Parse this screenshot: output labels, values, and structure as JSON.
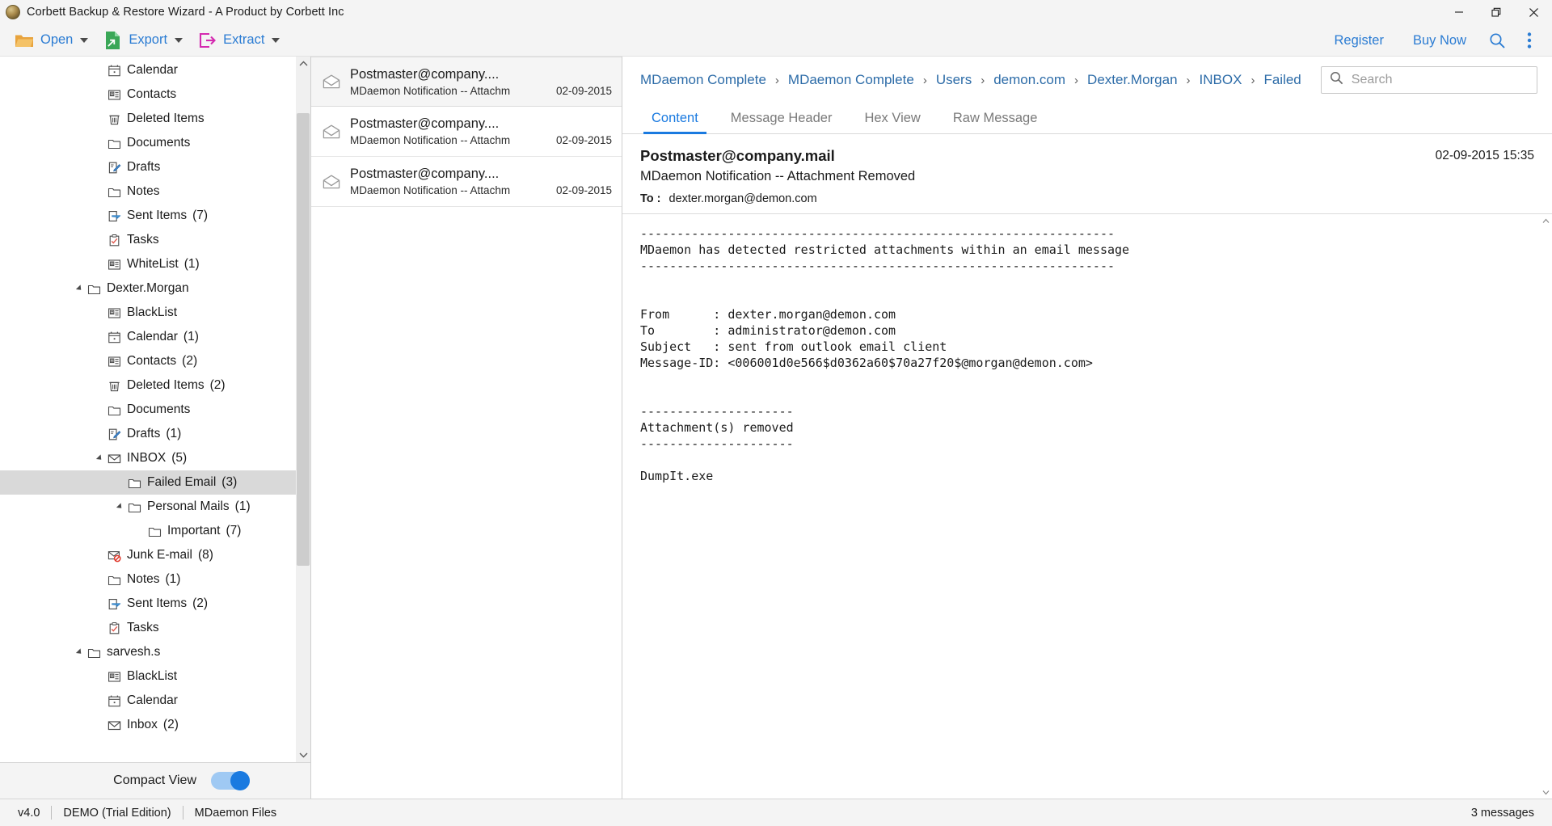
{
  "window": {
    "title": "Corbett Backup & Restore Wizard - A Product by Corbett Inc",
    "logo_icon": "corbett-logo-icon",
    "minimize_icon": "minimize-icon",
    "restore_icon": "restore-icon",
    "close_icon": "close-icon"
  },
  "toolbar": {
    "groups": [
      {
        "label": "Open",
        "icon": "open-folder-icon"
      },
      {
        "label": "Export",
        "icon": "export-file-icon"
      },
      {
        "label": "Extract",
        "icon": "extract-arrow-icon"
      }
    ],
    "register_label": "Register",
    "buy_now_label": "Buy Now",
    "search_icon": "search-icon",
    "overflow_icon": "more-vertical-icon"
  },
  "sidebar": {
    "scroll_up_icon": "chevron-up-icon",
    "scroll_down_icon": "chevron-down-icon",
    "compact_view_label": "Compact View",
    "compact_view_on": true,
    "items": [
      {
        "label": "Calendar",
        "count": "",
        "indent": 2,
        "icon": "calendar-icon",
        "twisty": "none",
        "selected": false
      },
      {
        "label": "Contacts",
        "count": "",
        "indent": 2,
        "icon": "contacts-icon",
        "twisty": "none",
        "selected": false
      },
      {
        "label": "Deleted Items",
        "count": "",
        "indent": 2,
        "icon": "trash-icon",
        "twisty": "none",
        "selected": false
      },
      {
        "label": "Documents",
        "count": "",
        "indent": 2,
        "icon": "folder-icon",
        "twisty": "none",
        "selected": false
      },
      {
        "label": "Drafts",
        "count": "",
        "indent": 2,
        "icon": "drafts-icon",
        "twisty": "none",
        "selected": false
      },
      {
        "label": "Notes",
        "count": "",
        "indent": 2,
        "icon": "folder-icon",
        "twisty": "none",
        "selected": false
      },
      {
        "label": "Sent Items",
        "count": "(7)",
        "indent": 2,
        "icon": "sent-icon",
        "twisty": "none",
        "selected": false
      },
      {
        "label": "Tasks",
        "count": "",
        "indent": 2,
        "icon": "tasks-icon",
        "twisty": "none",
        "selected": false
      },
      {
        "label": "WhiteList",
        "count": "(1)",
        "indent": 2,
        "icon": "contacts-icon",
        "twisty": "none",
        "selected": false
      },
      {
        "label": "Dexter.Morgan",
        "count": "",
        "indent": 1,
        "icon": "folder-icon",
        "twisty": "expanded",
        "selected": false
      },
      {
        "label": "BlackList",
        "count": "",
        "indent": 2,
        "icon": "contacts-icon",
        "twisty": "none",
        "selected": false
      },
      {
        "label": "Calendar",
        "count": "(1)",
        "indent": 2,
        "icon": "calendar-icon",
        "twisty": "none",
        "selected": false
      },
      {
        "label": "Contacts",
        "count": "(2)",
        "indent": 2,
        "icon": "contacts-icon",
        "twisty": "none",
        "selected": false
      },
      {
        "label": "Deleted Items",
        "count": "(2)",
        "indent": 2,
        "icon": "trash-icon",
        "twisty": "none",
        "selected": false
      },
      {
        "label": "Documents",
        "count": "",
        "indent": 2,
        "icon": "folder-icon",
        "twisty": "none",
        "selected": false
      },
      {
        "label": "Drafts",
        "count": "(1)",
        "indent": 2,
        "icon": "drafts-icon",
        "twisty": "none",
        "selected": false
      },
      {
        "label": "INBOX",
        "count": "(5)",
        "indent": 2,
        "icon": "envelope-icon",
        "twisty": "expanded",
        "selected": false
      },
      {
        "label": "Failed Email",
        "count": "(3)",
        "indent": 3,
        "icon": "folder-icon",
        "twisty": "none",
        "selected": true
      },
      {
        "label": "Personal Mails",
        "count": "(1)",
        "indent": 3,
        "icon": "folder-icon",
        "twisty": "expanded",
        "selected": false
      },
      {
        "label": "Important",
        "count": "(7)",
        "indent": 4,
        "icon": "folder-icon",
        "twisty": "none",
        "selected": false
      },
      {
        "label": "Junk E-mail",
        "count": "(8)",
        "indent": 2,
        "icon": "junk-icon",
        "twisty": "none",
        "selected": false
      },
      {
        "label": "Notes",
        "count": "(1)",
        "indent": 2,
        "icon": "folder-icon",
        "twisty": "none",
        "selected": false
      },
      {
        "label": "Sent Items",
        "count": "(2)",
        "indent": 2,
        "icon": "sent-icon",
        "twisty": "none",
        "selected": false
      },
      {
        "label": "Tasks",
        "count": "",
        "indent": 2,
        "icon": "tasks-icon",
        "twisty": "none",
        "selected": false
      },
      {
        "label": "sarvesh.s",
        "count": "",
        "indent": 1,
        "icon": "folder-icon",
        "twisty": "expanded",
        "selected": false
      },
      {
        "label": "BlackList",
        "count": "",
        "indent": 2,
        "icon": "contacts-icon",
        "twisty": "none",
        "selected": false
      },
      {
        "label": "Calendar",
        "count": "",
        "indent": 2,
        "icon": "calendar-icon",
        "twisty": "none",
        "selected": false
      },
      {
        "label": "Inbox",
        "count": "(2)",
        "indent": 2,
        "icon": "envelope-icon",
        "twisty": "none",
        "selected": false
      }
    ]
  },
  "message_list": {
    "messages": [
      {
        "from": "Postmaster@company....",
        "subject": "MDaemon Notification -- Attachm",
        "date": "02-09-2015",
        "icon": "envelope-open-icon",
        "selected": true
      },
      {
        "from": "Postmaster@company....",
        "subject": "MDaemon Notification -- Attachm",
        "date": "02-09-2015",
        "icon": "envelope-open-icon",
        "selected": false
      },
      {
        "from": "Postmaster@company....",
        "subject": "MDaemon Notification -- Attachm",
        "date": "02-09-2015",
        "icon": "envelope-open-icon",
        "selected": false
      }
    ]
  },
  "reader": {
    "breadcrumbs": [
      "MDaemon Complete",
      "MDaemon Complete",
      "Users",
      "demon.com",
      "Dexter.Morgan",
      "INBOX",
      "Failed"
    ],
    "breadcrumb_separator": "›",
    "search": {
      "placeholder": "Search",
      "value": "",
      "icon": "search-icon"
    },
    "tabs": [
      {
        "label": "Content",
        "active": true
      },
      {
        "label": "Message Header",
        "active": false
      },
      {
        "label": "Hex View",
        "active": false
      },
      {
        "label": "Raw Message",
        "active": false
      }
    ],
    "header": {
      "from": "Postmaster@company.mail",
      "subject": "MDaemon Notification -- Attachment Removed",
      "to_label": "To :",
      "to_value": "dexter.morgan@demon.com",
      "datetime": "02-09-2015 15:35"
    },
    "content_text": "-----------------------------------------------------------------\nMDaemon has detected restricted attachments within an email message\n-----------------------------------------------------------------\n\n\nFrom      : dexter.morgan@demon.com\nTo        : administrator@demon.com\nSubject   : sent from outlook email client\nMessage-ID: <006001d0e566$d0362a60$70a27f20$@morgan@demon.com>\n\n\n---------------------\nAttachment(s) removed\n---------------------\n\nDumpIt.exe",
    "scroll_up_icon": "chevron-up-icon",
    "scroll_down_icon": "chevron-down-icon"
  },
  "statusbar": {
    "version": "v4.0",
    "edition": "DEMO (Trial Edition)",
    "source": "MDaemon Files",
    "message_count": "3 messages"
  },
  "colors": {
    "accent_blue": "#2b7cd3",
    "tab_active": "#1a7ae0",
    "crumb_blue": "#2d6ca8",
    "chrome_bg": "#f4f4f4",
    "selection": "#d9d9d9"
  }
}
